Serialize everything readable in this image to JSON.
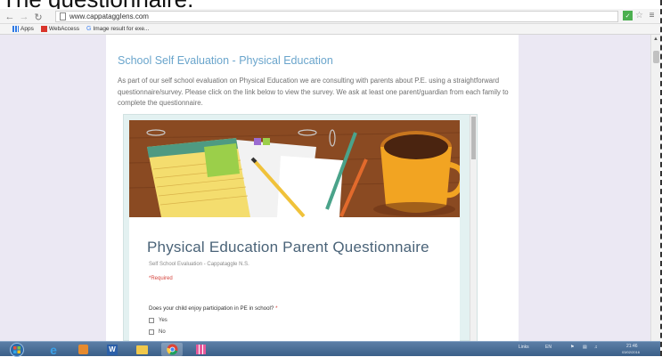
{
  "caption": "The questionnaire.",
  "browser": {
    "url": "www.cappataggIens.com",
    "bookmarks": [
      "Apps",
      "WebAccess",
      "Image result for exe..."
    ]
  },
  "page": {
    "title": "School Self Evaluation - Physical Education",
    "intro": "As part of our self school evaluation on Physical Education we are consulting with parents about P.E. using a straightforward questionnaire/survey. Please click on the link below to view the survey. We ask at least one parent/guardian from each family to complete the questionnaire."
  },
  "form": {
    "title": "Physical Education Parent Questionnaire",
    "subtitle": "Self School Evaluation - Cappataggle N.S.",
    "required": "*Required",
    "question": "Does your child enjoy participation in PE in school?",
    "required_star": "*",
    "options": [
      "Yes",
      "No"
    ]
  },
  "taskbar": {
    "tray_links": "Links",
    "tray_lang": "EN",
    "time": "21:46",
    "date": "03/02/2016"
  },
  "colors": {
    "title_blue": "#6aa5cc",
    "page_bg": "#ebe8f3",
    "form_title": "#4a6378",
    "required_red": "#d6463f"
  }
}
